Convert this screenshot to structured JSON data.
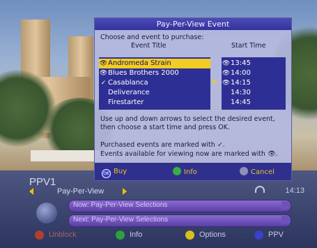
{
  "dialog": {
    "title": "Pay-Per-View Event",
    "prompt": "Choose and event to purchase:",
    "col_title": "Event Title",
    "col_time": "Start Time",
    "events": [
      {
        "title": "Andromeda Strain",
        "mark": "eye",
        "selected": true
      },
      {
        "title": "Blues Brothers 2000",
        "mark": "eye",
        "selected": false
      },
      {
        "title": "Casablanca",
        "mark": "check",
        "selected": false
      },
      {
        "title": "Deliverance",
        "mark": "",
        "selected": false
      },
      {
        "title": "Firestarter",
        "mark": "",
        "selected": false
      }
    ],
    "times": [
      {
        "time": "13:45",
        "mark": "eye"
      },
      {
        "time": "14:00",
        "mark": "eye"
      },
      {
        "time": "14:15",
        "mark": "eye"
      },
      {
        "time": "14:30",
        "mark": ""
      },
      {
        "time": "14:45",
        "mark": ""
      }
    ],
    "instruction_1": "Use up and down arrows to select the desired event,",
    "instruction_2": "then choose a start time and press OK.",
    "legend_purchased": "Purchased events are marked with ✓.",
    "legend_available": "Events available for viewing now are marked with 👁.",
    "buttons": {
      "ok_key": "OK",
      "buy": "Buy",
      "info": "Info",
      "cancel": "Cancel"
    }
  },
  "infobar": {
    "channel": "PPV1",
    "service": "Pay-Per-View",
    "clock": "14:13",
    "now_label": "Now: Pay-Per-View Selections",
    "next_label": "Next: Pay-Per-View Selections",
    "keys": [
      {
        "label": "Unblock",
        "color": "#b0402e"
      },
      {
        "label": "Info",
        "color": "#2fa040"
      },
      {
        "label": "Options",
        "color": "#d6c01a"
      },
      {
        "label": "PPV",
        "color": "#3a40c8"
      }
    ]
  },
  "colors": {
    "selection": "#f2cc22",
    "list_bg": "#2e2f94",
    "title_bar": "#3e3cb0",
    "accent_yellow": "#f0c000"
  },
  "icons": {
    "eye": "eye-icon",
    "check": "check-icon",
    "headphones": "headphones-icon"
  }
}
